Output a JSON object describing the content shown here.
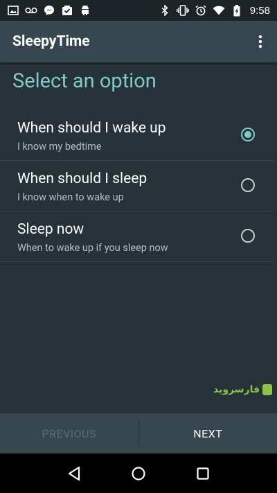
{
  "status_bar": {
    "time": "9:58",
    "left_icons": [
      "image-icon",
      "voicemail-icon",
      "messenger-icon",
      "inbox-icon",
      "android-icon"
    ],
    "right_icons": [
      "bluetooth-icon",
      "vibrate-icon",
      "alarm-icon",
      "wifi-icon",
      "battery-charging-icon"
    ]
  },
  "app_bar": {
    "title": "SleepyTime",
    "overflow_icon": "more-vert-icon"
  },
  "main": {
    "section_title": "Select an option",
    "options": [
      {
        "title": "When should I wake up",
        "subtitle": "I know my bedtime",
        "selected": true
      },
      {
        "title": "When should I sleep",
        "subtitle": "I know when to wake up",
        "selected": false
      },
      {
        "title": "Sleep now",
        "subtitle": "When to wake up if you sleep now",
        "selected": false
      }
    ]
  },
  "watermark": {
    "text": "فارسروید"
  },
  "bottom_bar": {
    "previous_label": "PREVIOUS",
    "next_label": "NEXT"
  },
  "nav_bar": {
    "buttons": [
      "back-icon",
      "home-icon",
      "recents-icon"
    ]
  },
  "colors": {
    "background": "#263238",
    "app_bar": "#37474f",
    "accent": "#80cbc4",
    "disabled_text": "#546e7a"
  }
}
